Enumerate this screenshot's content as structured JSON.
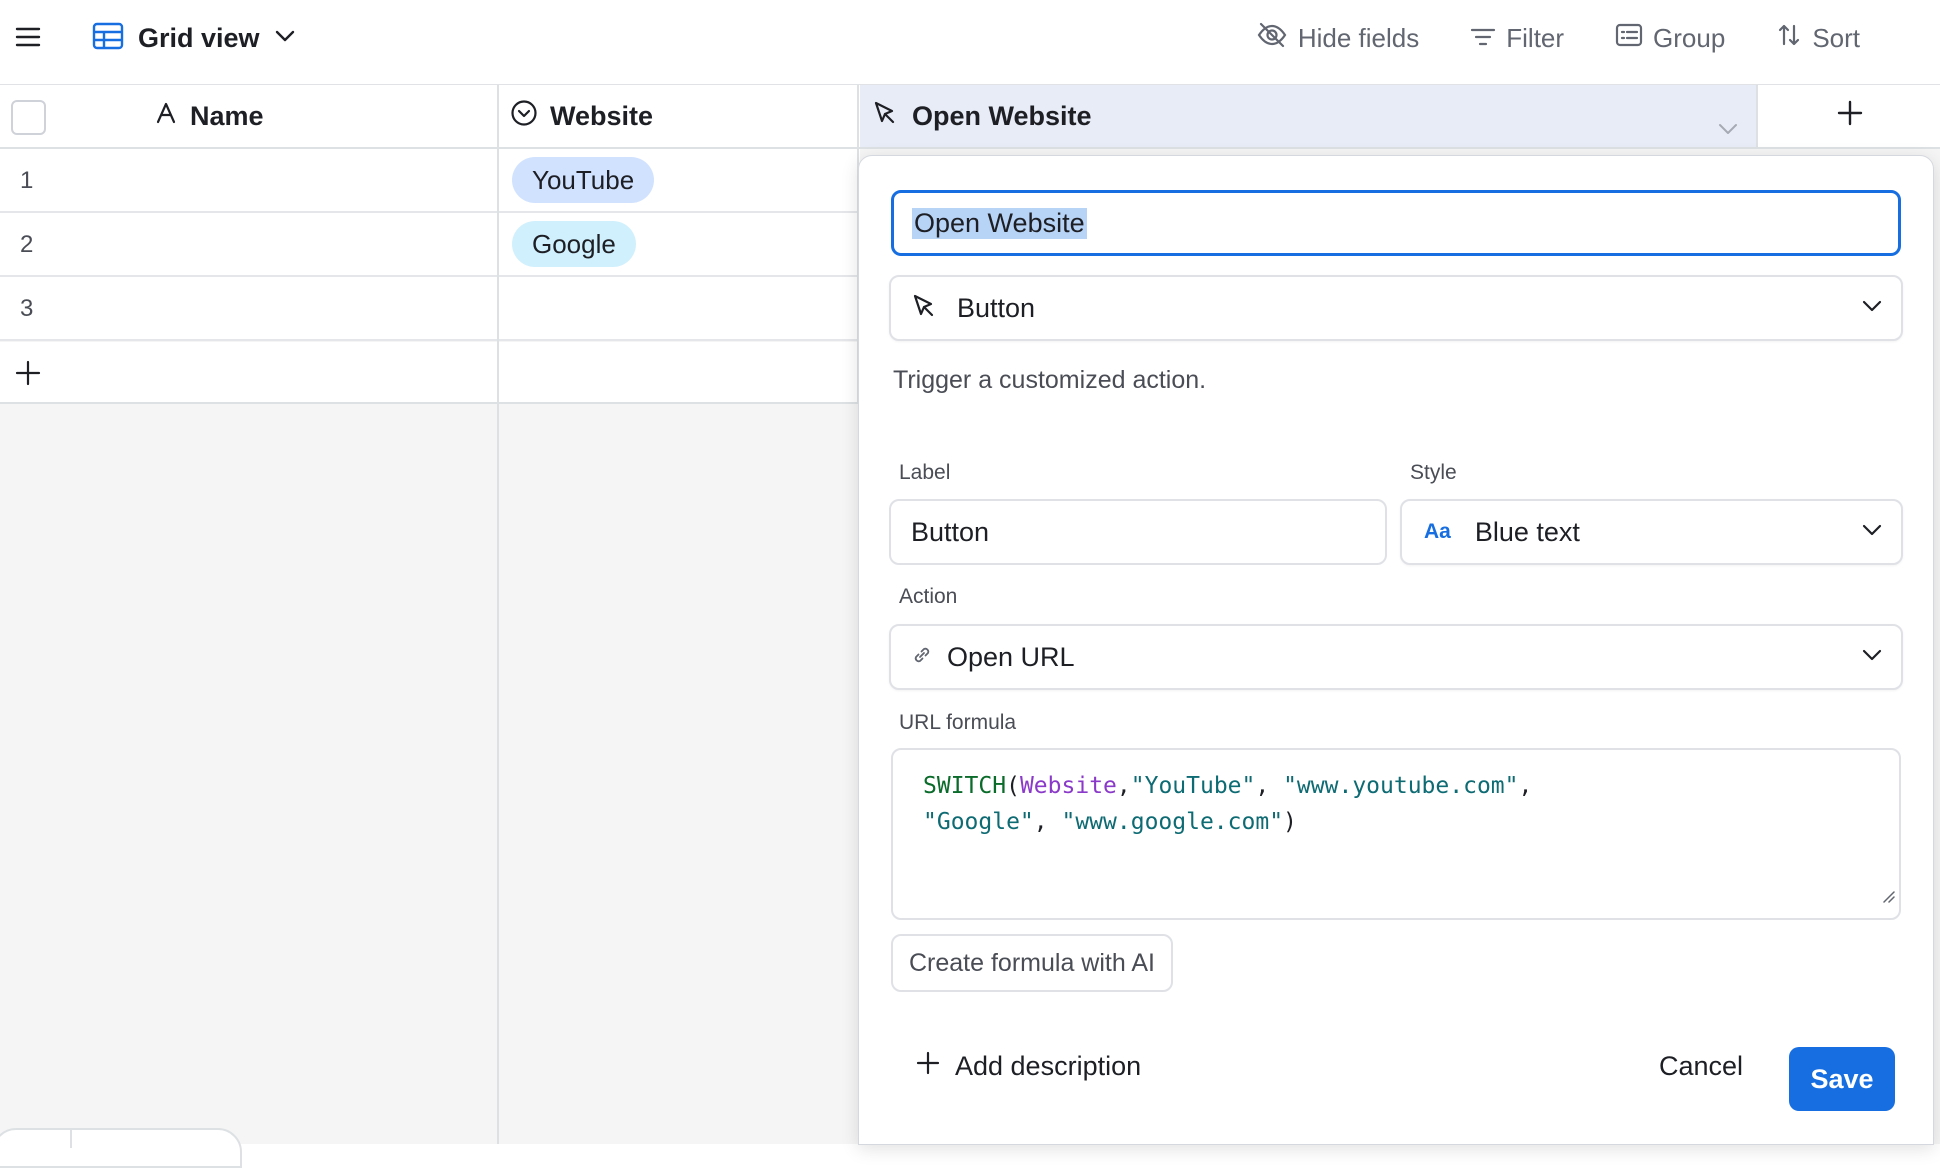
{
  "toolbar": {
    "view_name": "Grid view",
    "hide_fields": "Hide fields",
    "filter": "Filter",
    "group": "Group",
    "sort": "Sort"
  },
  "grid": {
    "columns": [
      {
        "label": "Name",
        "icon": "text-field-icon"
      },
      {
        "label": "Website",
        "icon": "single-select-icon"
      },
      {
        "label": "Open Website",
        "icon": "cursor-button-icon"
      }
    ],
    "rows": [
      {
        "num": "1",
        "website": "YouTube",
        "pill_color": "#d1e2ff"
      },
      {
        "num": "2",
        "website": "Google",
        "pill_color": "#d0f0fd"
      },
      {
        "num": "3",
        "website": ""
      }
    ]
  },
  "editor": {
    "field_name": "Open Website",
    "field_type": "Button",
    "type_description": "Trigger a customized action.",
    "label_caption": "Label",
    "label_value": "Button",
    "style_caption": "Style",
    "style_icon_text": "Aa",
    "style_value": "Blue text",
    "action_caption": "Action",
    "action_value": "Open URL",
    "url_caption": "URL formula",
    "formula": {
      "fn": "SWITCH",
      "field": "Website",
      "arg1": "\"YouTube\"",
      "arg2": "\"www.youtube.com\"",
      "arg3": "\"Google\"",
      "arg4": "\"www.google.com\""
    },
    "ai_button": "Create formula with AI",
    "add_description": "Add description",
    "cancel": "Cancel",
    "save": "Save"
  },
  "colors": {
    "accent": "#166ee1",
    "active_header": "#e8ecf6"
  }
}
